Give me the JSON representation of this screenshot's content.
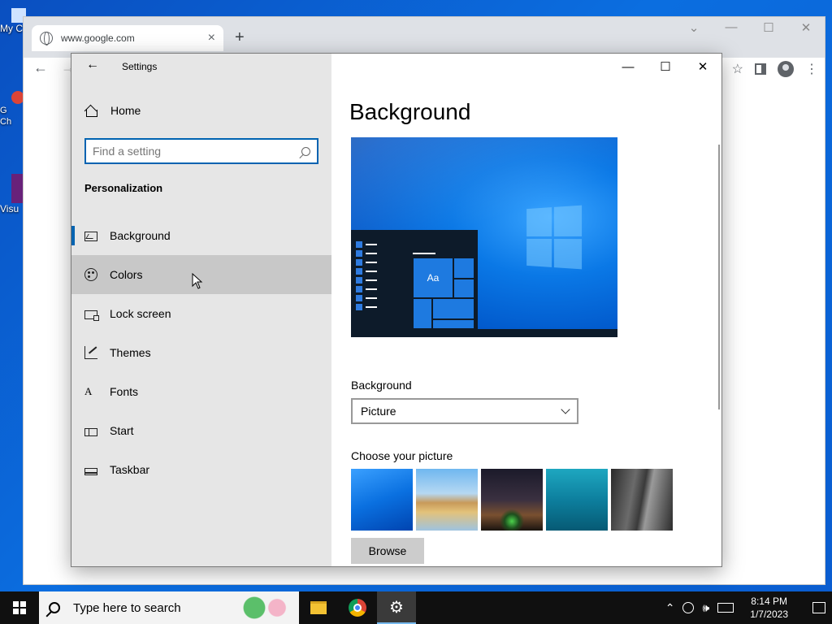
{
  "desktop": {
    "icons": [
      {
        "label": "My C"
      },
      {
        "label": "G\nCh"
      },
      {
        "label": "Visu"
      }
    ]
  },
  "browser": {
    "tab_title": "www.google.com",
    "tab_close": "×",
    "new_tab": "+",
    "controls": {
      "chevron": "⌄",
      "minimize": "—",
      "maximize": "☐",
      "close": "✕"
    }
  },
  "settings": {
    "window_title": "Settings",
    "home_label": "Home",
    "search_placeholder": "Find a setting",
    "section_title": "Personalization",
    "nav_items": [
      {
        "label": "Background",
        "icon": "picture-icon"
      },
      {
        "label": "Colors",
        "icon": "palette-icon"
      },
      {
        "label": "Lock screen",
        "icon": "lock-screen-icon"
      },
      {
        "label": "Themes",
        "icon": "brush-icon"
      },
      {
        "label": "Fonts",
        "icon": "font-icon"
      },
      {
        "label": "Start",
        "icon": "start-icon"
      },
      {
        "label": "Taskbar",
        "icon": "taskbar-icon"
      }
    ],
    "selected_item": "Background",
    "hovered_item": "Colors",
    "controls": {
      "minimize": "—",
      "maximize": "☐",
      "close": "✕"
    },
    "page_title": "Background",
    "preview_tile_text": "Aa",
    "background_label": "Background",
    "background_value": "Picture",
    "choose_picture_label": "Choose your picture",
    "browse_label": "Browse",
    "accent_color": "#0063b1"
  },
  "taskbar": {
    "search_placeholder": "Type here to search",
    "time": "8:14 PM",
    "date": "1/7/2023",
    "tray_icons": [
      "chevron-up-icon",
      "network-icon",
      "volume-icon",
      "keyboard-icon"
    ]
  }
}
